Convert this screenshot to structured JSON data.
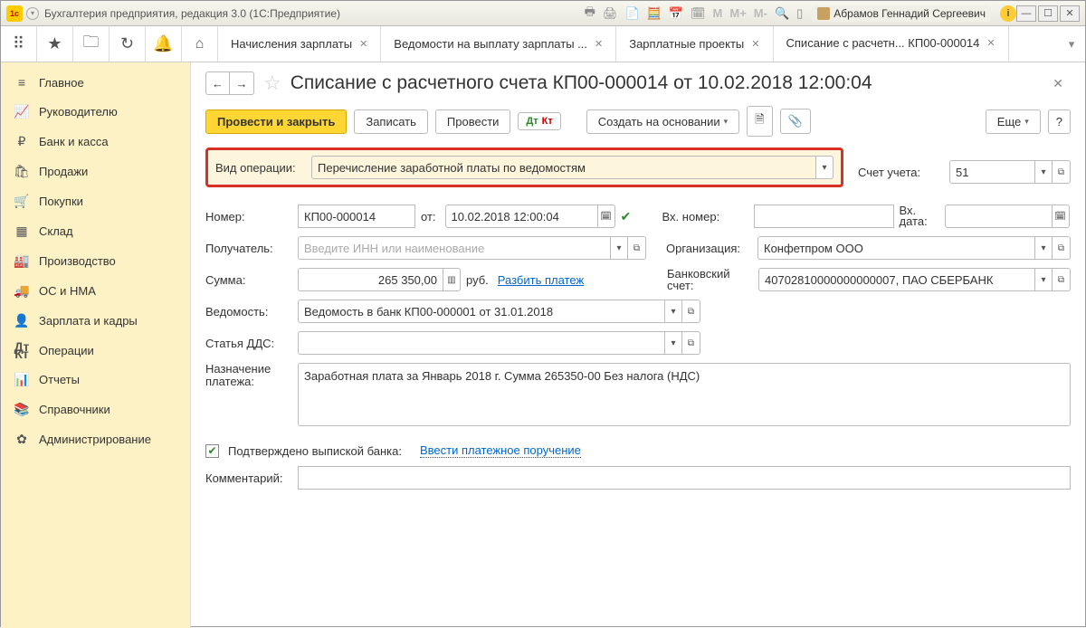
{
  "titlebar": {
    "app_title": "Бухгалтерия предприятия, редакция 3.0  (1С:Предприятие)",
    "user_name": "Абрамов Геннадий Сергеевич",
    "m_labels": [
      "M",
      "M+",
      "M-"
    ]
  },
  "tabs": [
    {
      "label": "Начисления зарплаты",
      "closable": true
    },
    {
      "label": "Ведомости на выплату зарплаты ...",
      "closable": true
    },
    {
      "label": "Зарплатные проекты",
      "closable": true
    },
    {
      "label": "Списание с расчетн... КП00-000014",
      "closable": true,
      "active": true
    }
  ],
  "sidebar": {
    "items": [
      {
        "icon": "≡",
        "label": "Главное"
      },
      {
        "icon": "↗",
        "label": "Руководителю"
      },
      {
        "icon": "₽",
        "label": "Банк и касса"
      },
      {
        "icon": "🛍",
        "label": "Продажи"
      },
      {
        "icon": "🛒",
        "label": "Покупки"
      },
      {
        "icon": "▥",
        "label": "Склад"
      },
      {
        "icon": "🏭",
        "label": "Производство"
      },
      {
        "icon": "🚚",
        "label": "ОС и НМА"
      },
      {
        "icon": "👤",
        "label": "Зарплата и кадры"
      },
      {
        "icon": "Дт/Кт",
        "label": "Операции"
      },
      {
        "icon": "📊",
        "label": "Отчеты"
      },
      {
        "icon": "📚",
        "label": "Справочники"
      },
      {
        "icon": "⚙",
        "label": "Администрирование"
      }
    ]
  },
  "doc": {
    "title": "Списание с расчетного счета КП00-000014 от 10.02.2018 12:00:04",
    "actions": {
      "post_close": "Провести и закрыть",
      "save": "Записать",
      "post": "Провести",
      "create_based": "Создать на основании",
      "more": "Еще",
      "help": "?"
    },
    "fields": {
      "operation_type_label": "Вид операции:",
      "operation_type_value": "Перечисление заработной платы по ведомостям",
      "account_label": "Счет учета:",
      "account_value": "51",
      "number_label": "Номер:",
      "number_value": "КП00-000014",
      "date_label": "от:",
      "date_value": "10.02.2018 12:00:04",
      "in_number_label": "Вх. номер:",
      "in_date_label": "Вх. дата:",
      "recipient_label": "Получатель:",
      "recipient_placeholder": "Введите ИНН или наименование",
      "organization_label": "Организация:",
      "organization_value": "Конфетпром ООО",
      "amount_label": "Сумма:",
      "amount_value": "265 350,00",
      "amount_currency": "руб.",
      "split_payment": "Разбить платеж",
      "bank_account_label": "Банковский счет:",
      "bank_account_value": "40702810000000000007, ПАО СБЕРБАНК",
      "statement_label": "Ведомость:",
      "statement_value": "Ведомость в банк КП00-000001 от 31.01.2018",
      "dds_label": "Статья ДДС:",
      "purpose_label": "Назначение платежа:",
      "purpose_value": "Заработная плата за Январь 2018 г. Сумма 265350-00 Без налога (НДС)",
      "confirmed_label": "Подтверждено выпиской банка:",
      "enter_order": "Ввести платежное поручение",
      "comment_label": "Комментарий:"
    }
  }
}
